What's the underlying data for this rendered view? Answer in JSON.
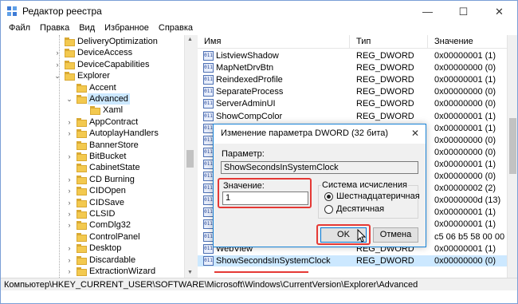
{
  "window": {
    "title": "Редактор реестра",
    "controls": {
      "minimize": "—",
      "maximize": "☐",
      "close": "✕"
    }
  },
  "menu": [
    "Файл",
    "Правка",
    "Вид",
    "Избранное",
    "Справка"
  ],
  "tree": [
    {
      "label": "DeliveryOptimization",
      "expandable": false,
      "level": 0
    },
    {
      "label": "DeviceAccess",
      "expandable": true,
      "level": 0
    },
    {
      "label": "DeviceCapabilities",
      "expandable": true,
      "level": 0
    },
    {
      "label": "Explorer",
      "expandable": true,
      "expanded": true,
      "level": 0
    },
    {
      "label": "Accent",
      "expandable": false,
      "level": 1
    },
    {
      "label": "Advanced",
      "expandable": true,
      "expanded": true,
      "level": 1,
      "selected": true
    },
    {
      "label": "Xaml",
      "expandable": false,
      "level": 2
    },
    {
      "label": "AppContract",
      "expandable": true,
      "level": 1
    },
    {
      "label": "AutoplayHandlers",
      "expandable": true,
      "level": 1
    },
    {
      "label": "BannerStore",
      "expandable": false,
      "level": 1
    },
    {
      "label": "BitBucket",
      "expandable": true,
      "level": 1
    },
    {
      "label": "CabinetState",
      "expandable": false,
      "level": 1
    },
    {
      "label": "CD Burning",
      "expandable": true,
      "level": 1
    },
    {
      "label": "CIDOpen",
      "expandable": true,
      "level": 1
    },
    {
      "label": "CIDSave",
      "expandable": true,
      "level": 1
    },
    {
      "label": "CLSID",
      "expandable": true,
      "level": 1
    },
    {
      "label": "ComDlg32",
      "expandable": true,
      "level": 1
    },
    {
      "label": "ControlPanel",
      "expandable": false,
      "level": 1
    },
    {
      "label": "Desktop",
      "expandable": true,
      "level": 1
    },
    {
      "label": "Discardable",
      "expandable": true,
      "level": 1
    },
    {
      "label": "ExtractionWizard",
      "expandable": true,
      "level": 1
    }
  ],
  "list": {
    "headers": {
      "name": "Имя",
      "type": "Тип",
      "value": "Значение"
    },
    "rows": [
      {
        "name": "ListviewShadow",
        "type": "REG_DWORD",
        "value": "0x00000001 (1)"
      },
      {
        "name": "MapNetDrvBtn",
        "type": "REG_DWORD",
        "value": "0x00000000 (0)"
      },
      {
        "name": "ReindexedProfile",
        "type": "REG_DWORD",
        "value": "0x00000001 (1)"
      },
      {
        "name": "SeparateProcess",
        "type": "REG_DWORD",
        "value": "0x00000000 (0)"
      },
      {
        "name": "ServerAdminUI",
        "type": "REG_DWORD",
        "value": "0x00000000 (0)"
      },
      {
        "name": "ShowCompColor",
        "type": "REG_DWORD",
        "value": "0x00000001 (1)"
      },
      {
        "name": "",
        "type": "",
        "value": "0x00000001 (1)"
      },
      {
        "name": "",
        "type": "",
        "value": "0x00000000 (0)"
      },
      {
        "name": "",
        "type": "",
        "value": "0x00000000 (0)"
      },
      {
        "name": "",
        "type": "",
        "value": "0x00000001 (1)"
      },
      {
        "name": "",
        "type": "",
        "value": "0x00000000 (0)"
      },
      {
        "name": "",
        "type": "",
        "value": "0x00000002 (2)"
      },
      {
        "name": "",
        "type": "",
        "value": "0x0000000d (13)"
      },
      {
        "name": "",
        "type": "",
        "value": "0x00000001 (1)"
      },
      {
        "name": "",
        "type": "",
        "value": "0x00000001 (1)"
      },
      {
        "name": "",
        "type": "",
        "value": "c5 06 b5 58 00 00 00 00"
      },
      {
        "name": "WebView",
        "type": "REG_DWORD",
        "value": "0x00000001 (1)"
      },
      {
        "name": "ShowSecondsInSystemClock",
        "type": "REG_DWORD",
        "value": "0x00000000 (0)",
        "highlighted": true
      }
    ]
  },
  "status": "Компьютер\\HKEY_CURRENT_USER\\SOFTWARE\\Microsoft\\Windows\\CurrentVersion\\Explorer\\Advanced",
  "dialog": {
    "title": "Изменение параметра DWORD (32 бита)",
    "close": "✕",
    "param_label": "Параметр:",
    "param_value": "ShowSecondsInSystemClock",
    "value_label": "Значение:",
    "value": "1",
    "base_group_label": "Система исчисления",
    "base_options": [
      {
        "label": "Шестнадцатеричная",
        "selected": true
      },
      {
        "label": "Десятичная",
        "selected": false
      }
    ],
    "ok_label": "OK",
    "cancel_label": "Отмена"
  },
  "colors": {
    "selection": "#cce8ff",
    "annotation_red": "#e53935",
    "folder": "#f3c94f",
    "accent": "#0078d7"
  }
}
